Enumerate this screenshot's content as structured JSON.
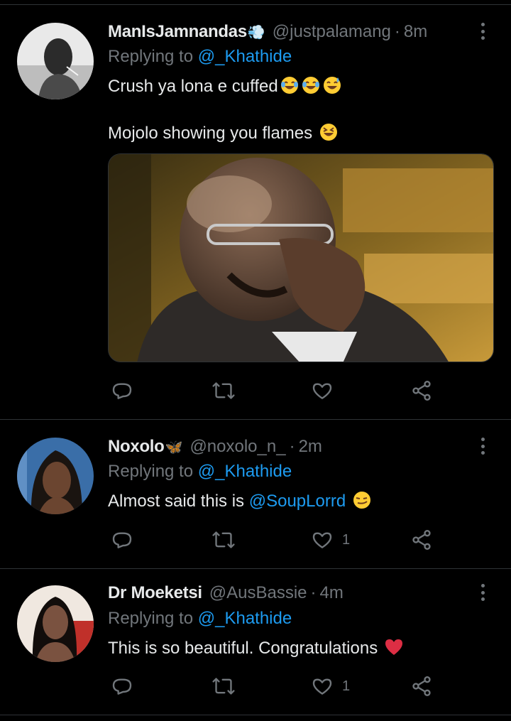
{
  "tweets": [
    {
      "display_name": "ManIsJamnandas",
      "name_emoji": "💨",
      "handle": "@justpalamang",
      "separator": "·",
      "time": "8m",
      "replying_prefix": "Replying to ",
      "replying_to": "@_Khathide",
      "text_lines": [
        "Crush ya lona e cuffed",
        "Mojolo showing you flames"
      ],
      "like_count": ""
    },
    {
      "display_name": "Noxolo",
      "name_emoji": "🦋",
      "handle": "@noxolo_n_",
      "separator": "·",
      "time": "2m",
      "replying_prefix": "Replying to ",
      "replying_to": "@_Khathide",
      "text_prefix": "Almost said this is ",
      "text_mention": "@SoupLorrd",
      "like_count": "1"
    },
    {
      "display_name": "Dr Moeketsi",
      "handle": "@AusBassie",
      "separator": "·",
      "time": "4m",
      "replying_prefix": "Replying to ",
      "replying_to": "@_Khathide",
      "text": "This is so beautiful. Congratulations",
      "like_count": "1"
    }
  ],
  "colors": {
    "background": "#000000",
    "text": "#e7e9ea",
    "muted": "#71767b",
    "mention": "#1d9bf0",
    "divider": "#2f3336",
    "heart": "#e0245e"
  },
  "icons": [
    "reply-icon",
    "retweet-icon",
    "like-icon",
    "share-icon",
    "more-icon"
  ]
}
